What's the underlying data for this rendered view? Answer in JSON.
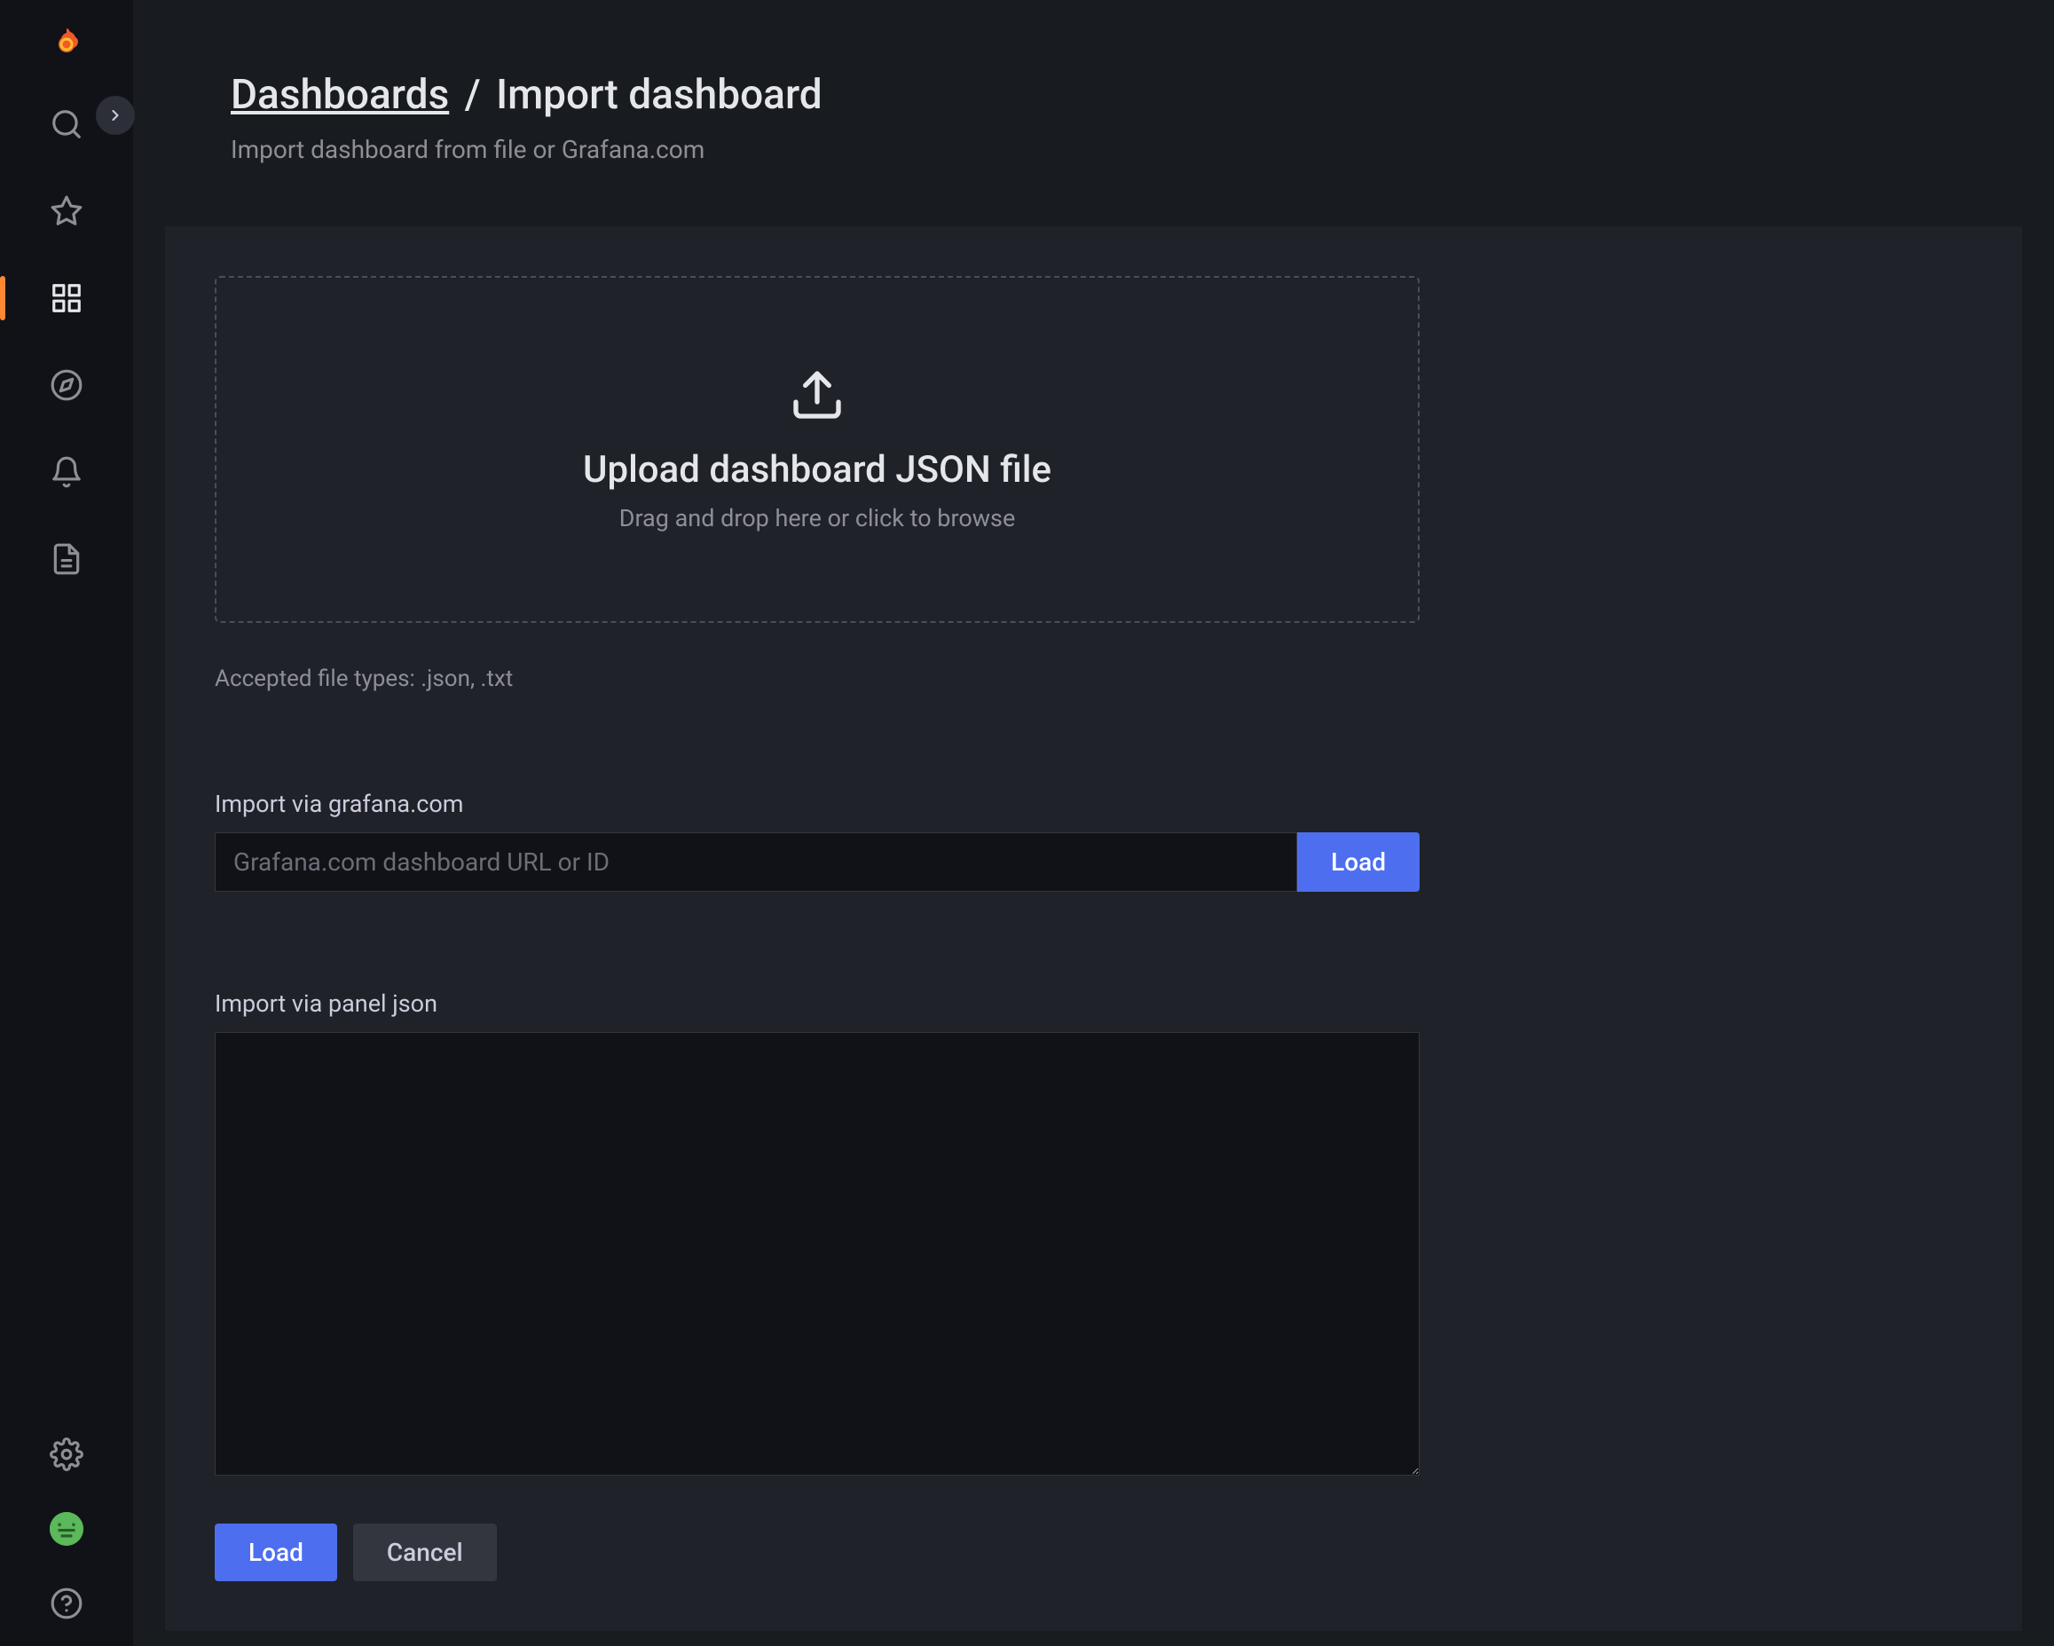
{
  "header": {
    "breadcrumb_root": "Dashboards",
    "separator": "/",
    "breadcrumb_current": "Import dashboard",
    "subtitle": "Import dashboard from file or Grafana.com"
  },
  "dropzone": {
    "title": "Upload dashboard JSON file",
    "subtitle": "Drag and drop here or click to browse"
  },
  "hints": {
    "accepted_types": "Accepted file types: .json, .txt"
  },
  "import_url": {
    "label": "Import via grafana.com",
    "placeholder": "Grafana.com dashboard URL or ID",
    "button": "Load"
  },
  "import_json": {
    "label": "Import via panel json"
  },
  "actions": {
    "load": "Load",
    "cancel": "Cancel"
  },
  "sidebar": {
    "icons": {
      "logo": "grafana-logo",
      "expand": "chevron-right",
      "search": "search",
      "starred": "star",
      "dashboards": "dashboards",
      "explore": "compass",
      "alerting": "bell",
      "admin": "clipboard",
      "settings": "gear",
      "profile": "avatar",
      "help": "help"
    }
  }
}
